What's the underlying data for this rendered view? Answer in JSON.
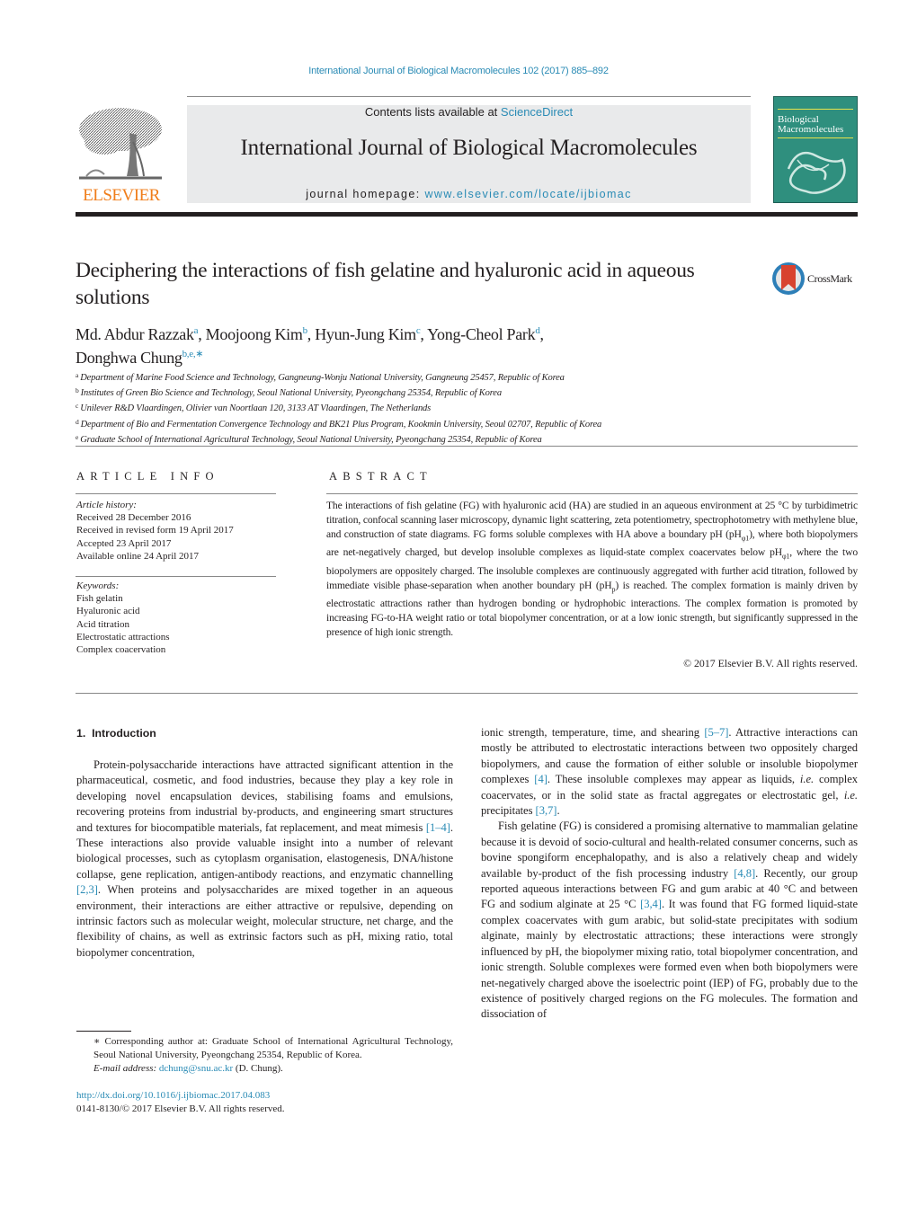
{
  "running_head": "International Journal of Biological Macromolecules 102 (2017) 885–892",
  "masthead": {
    "publisher_logo_text": "ELSEVIER",
    "contents_prefix": "Contents lists available at ",
    "contents_link": "ScienceDirect",
    "journal_title": "International Journal of Biological Macromolecules",
    "homepage_prefix": "journal homepage: ",
    "homepage_link": "www.elsevier.com/locate/ijbiomac",
    "cover_title_line1": "Biological",
    "cover_title_line2": "Macromolecules",
    "colors": {
      "link": "#2a8bb5",
      "elsevier_orange": "#f07d1a",
      "cover_green": "#2f8f7e",
      "masthead_bg": "#e9eaeb"
    }
  },
  "article": {
    "title": "Deciphering the interactions of fish gelatine and hyaluronic acid in aqueous solutions",
    "crossmark_label": "CrossMark",
    "authors": [
      {
        "name": "Md. Abdur Razzak",
        "sup": "a",
        "sep": ", "
      },
      {
        "name": "Moojoong Kim",
        "sup": "b",
        "sep": ", "
      },
      {
        "name": "Hyun-Jung Kim",
        "sup": "c",
        "sep": ", "
      },
      {
        "name": "Yong-Cheol Park",
        "sup": "d",
        "sep": ","
      },
      {
        "name": "Donghwa Chung",
        "sup": "b,e,∗",
        "sep": ""
      }
    ],
    "affiliations": [
      {
        "mark": "a",
        "text": "Department of Marine Food Science and Technology, Gangneung-Wonju National University, Gangneung 25457, Republic of Korea"
      },
      {
        "mark": "b",
        "text": "Institutes of Green Bio Science and Technology, Seoul National University, Pyeongchang 25354, Republic of Korea"
      },
      {
        "mark": "c",
        "text": "Unilever R&D Vlaardingen, Olivier van Noortlaan 120, 3133 AT Vlaardingen, The Netherlands"
      },
      {
        "mark": "d",
        "text": "Department of Bio and Fermentation Convergence Technology and BK21 Plus Program, Kookmin University, Seoul 02707, Republic of Korea"
      },
      {
        "mark": "e",
        "text": "Graduate School of International Agricultural Technology, Seoul National University, Pyeongchang 25354, Republic of Korea"
      }
    ]
  },
  "article_info": {
    "heading": "ARTICLE INFO",
    "history_label": "Article history:",
    "history": [
      "Received 28 December 2016",
      "Received in revised form 19 April 2017",
      "Accepted 23 April 2017",
      "Available online 24 April 2017"
    ],
    "keywords_label": "Keywords:",
    "keywords": [
      "Fish gelatin",
      "Hyaluronic acid",
      "Acid titration",
      "Electrostatic attractions",
      "Complex coacervation"
    ]
  },
  "abstract": {
    "heading": "ABSTRACT",
    "part1": "The interactions of fish gelatine (FG) with hyaluronic acid (HA) are studied in an aqueous environment at 25 °C by turbidimetric titration, confocal scanning laser microscopy, dynamic light scattering, zeta potentiometry, spectrophotometry with methylene blue, and construction of state diagrams. FG forms soluble complexes with HA above a boundary pH (pH",
    "sub1": "φ1",
    "part2": "), where both biopolymers are net-negatively charged, but develop insoluble complexes as liquid-state complex coacervates below pH",
    "sub2": "φ1",
    "part3": ", where the two biopolymers are oppositely charged. The insoluble complexes are continuously aggregated with further acid titration, followed by immediate visible phase-separation when another boundary pH (pH",
    "sub3": "p",
    "part4": ") is reached. The complex formation is mainly driven by electrostatic attractions rather than hydrogen bonding or hydrophobic interactions. The complex formation is promoted by increasing FG-to-HA weight ratio or total biopolymer concentration, or at a low ionic strength, but significantly suppressed in the presence of high ionic strength.",
    "copyright": "© 2017 Elsevier B.V. All rights reserved."
  },
  "body": {
    "section_heading": "1.  Introduction",
    "p1_a": "Protein-polysaccharide interactions have attracted significant attention in the pharmaceutical, cosmetic, and food industries, because they play a key role in developing novel encapsulation devices, stabilising foams and emulsions, recovering proteins from industrial by-products, and engineering smart structures and textures for biocompatible materials, fat replacement, and meat mimesis ",
    "p1_ref1": "[1–4]",
    "p1_b": ". These interactions also provide valuable insight into a number of relevant biological processes, such as cytoplasm organisation, elastogenesis, DNA/histone collapse, gene replication, antigen-antibody reactions, and enzymatic channelling ",
    "p1_ref2": "[2,3]",
    "p1_c": ". When proteins and polysaccharides are mixed together in an aqueous environment, their interactions are either attractive or repulsive, depending on intrinsic factors such as molecular weight, molecular structure, net charge, and the flexibility of chains, as well as extrinsic factors such as pH, mixing ratio, total biopolymer concentration,",
    "r1_a": "ionic strength, temperature, time, and shearing ",
    "r1_ref1": "[5–7]",
    "r1_b": ". Attractive interactions can mostly be attributed to electrostatic interactions between two oppositely charged biopolymers, and cause the formation of either soluble or insoluble biopolymer complexes ",
    "r1_ref2": "[4]",
    "r1_c": ". These insoluble complexes may appear as liquids, ",
    "r1_ie1": "i.e.",
    "r1_d": " complex coacervates, or in the solid state as fractal aggregates or electrostatic gel, ",
    "r1_ie2": "i.e.",
    "r1_e": " precipitates ",
    "r1_ref3": "[3,7]",
    "r1_f": ".",
    "p2_a": "Fish gelatine (FG) is considered a promising alternative to mammalian gelatine because it is devoid of socio-cultural and health-related consumer concerns, such as bovine spongiform encephalopathy, and is also a relatively cheap and widely available by-product of the fish processing industry ",
    "p2_ref1": "[4,8]",
    "p2_b": ". Recently, our group reported aqueous interactions between FG and gum arabic at 40 °C and between FG and sodium alginate at 25 °C ",
    "p2_ref2": "[3,4]",
    "p2_c": ". It was found that FG formed liquid-state complex coacervates with gum arabic, but solid-state precipitates with sodium alginate, mainly by electrostatic attractions; these interactions were strongly influenced by pH, the biopolymer mixing ratio, total biopolymer concentration, and ionic strength. Soluble complexes were formed even when both biopolymers were net-negatively charged above the isoelectric point (IEP) of FG, probably due to the existence of positively charged regions on the FG molecules. The formation and dissociation of"
  },
  "footnotes": {
    "corresponding": "∗  Corresponding author at: Graduate School of International Agricultural Technology, Seoul National University, Pyeongchang 25354, Republic of Korea.",
    "email_label": "E-mail address:",
    "email": "dchung@snu.ac.kr",
    "email_suffix": " (D. Chung).",
    "doi": "http://dx.doi.org/10.1016/j.ijbiomac.2017.04.083",
    "issn_line": "0141-8130/© 2017 Elsevier B.V. All rights reserved."
  }
}
